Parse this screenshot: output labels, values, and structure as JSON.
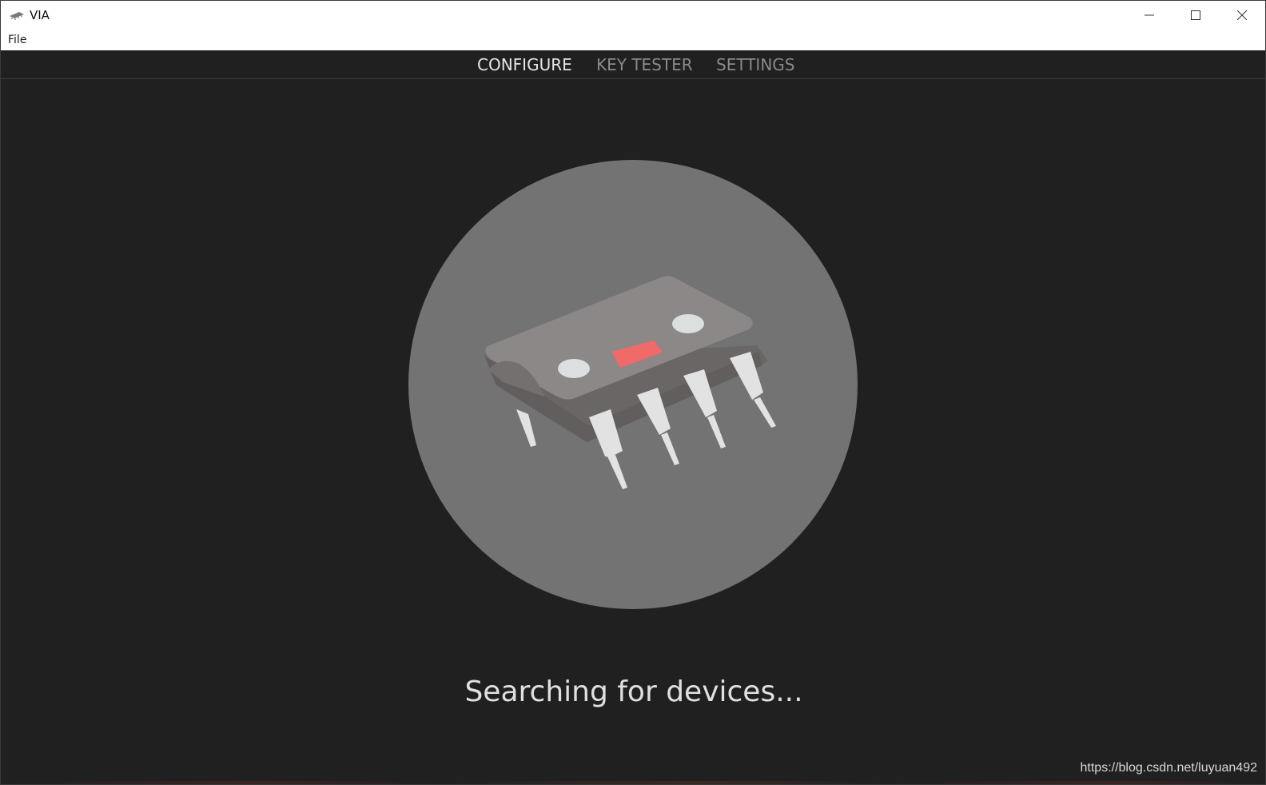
{
  "window": {
    "title": "VIA",
    "minimize_icon": "minimize-icon",
    "maximize_icon": "maximize-icon",
    "close_icon": "close-icon"
  },
  "menu": {
    "file_label": "File"
  },
  "nav": {
    "tabs": [
      {
        "label": "CONFIGURE",
        "active": true
      },
      {
        "label": "KEY TESTER",
        "active": false
      },
      {
        "label": "SETTINGS",
        "active": false
      }
    ]
  },
  "main": {
    "illustration_icon": "chip-icon",
    "status": "Searching for devices..."
  },
  "watermark": "https://blog.csdn.net/luyuan492",
  "colors": {
    "background": "#202020",
    "circle": "#737373",
    "chip_body": "#8c8888",
    "chip_led": "#f06a6a",
    "pins": "#e2e2e2",
    "active_tab": "#e6e6e6",
    "inactive_tab": "#8a8a8a"
  }
}
